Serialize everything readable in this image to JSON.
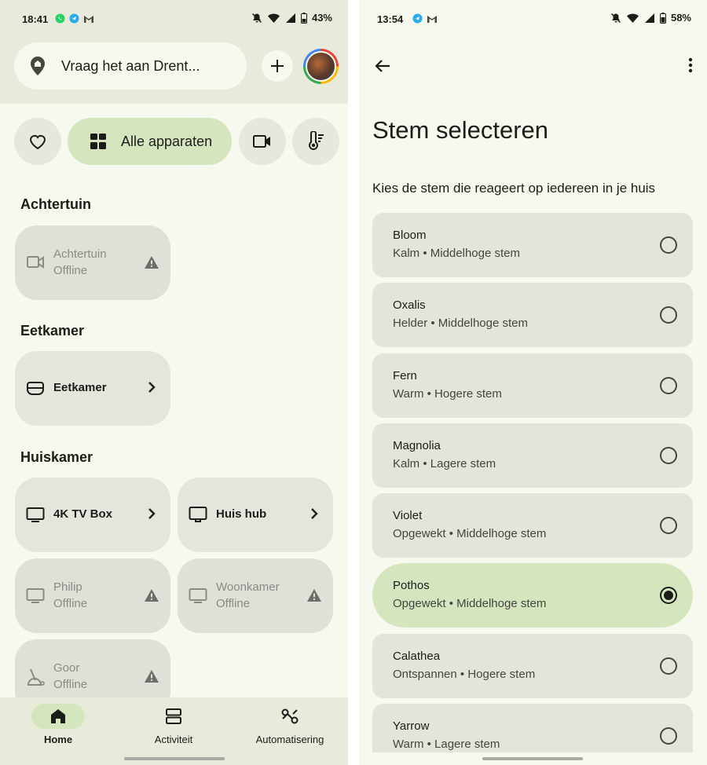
{
  "left": {
    "status": {
      "time": "18:41",
      "battery": "43%"
    },
    "search": {
      "placeholder": "Vraag het aan Drent..."
    },
    "chips": {
      "all_label": "Alle apparaten"
    },
    "sections": [
      {
        "title": "Achtertuin"
      },
      {
        "title": "Eetkamer"
      },
      {
        "title": "Huiskamer"
      }
    ],
    "devices": {
      "achtertuin": {
        "name": "Achtertuin",
        "status": "Offline",
        "icon": "camera-icon"
      },
      "eetkamer": {
        "name": "Eetkamer",
        "icon": "speaker-icon"
      },
      "tv_box": {
        "name": "4K TV Box",
        "icon": "tv-icon"
      },
      "huis_hub": {
        "name": "Huis hub",
        "icon": "display-icon"
      },
      "philip": {
        "name": "Philip",
        "status": "Offline",
        "icon": "tv-icon"
      },
      "woonkamer": {
        "name": "Woonkamer",
        "status": "Offline",
        "icon": "tv-icon"
      },
      "goor": {
        "name": "Goor",
        "status": "Offline",
        "icon": "vacuum-icon"
      }
    },
    "nav": [
      {
        "label": "Home",
        "icon": "home-icon",
        "active": true
      },
      {
        "label": "Activiteit",
        "icon": "activity-icon"
      },
      {
        "label": "Automatisering",
        "icon": "automation-icon"
      }
    ]
  },
  "right": {
    "status": {
      "time": "13:54",
      "battery": "58%"
    },
    "title": "Stem selecteren",
    "subtitle": "Kies de stem die reageert op iedereen in je huis",
    "voices": [
      {
        "name": "Bloom",
        "desc": "Kalm • Middelhoge stem",
        "selected": false
      },
      {
        "name": "Oxalis",
        "desc": "Helder • Middelhoge stem",
        "selected": false
      },
      {
        "name": "Fern",
        "desc": "Warm • Hogere stem",
        "selected": false
      },
      {
        "name": "Magnolia",
        "desc": "Kalm • Lagere stem",
        "selected": false
      },
      {
        "name": "Violet",
        "desc": "Opgewekt • Middelhoge stem",
        "selected": false
      },
      {
        "name": "Pothos",
        "desc": "Opgewekt • Middelhoge stem",
        "selected": true
      },
      {
        "name": "Calathea",
        "desc": "Ontspannen • Hogere stem",
        "selected": false
      },
      {
        "name": "Yarrow",
        "desc": "Warm • Lagere stem",
        "selected": false
      }
    ]
  },
  "colors": {
    "background": "#f7f8ee",
    "header": "#e8eadb",
    "accent": "#d5e6bf",
    "tile": "#e4e5dc",
    "text": "#1c1d19",
    "muted": "#8a8b85"
  }
}
